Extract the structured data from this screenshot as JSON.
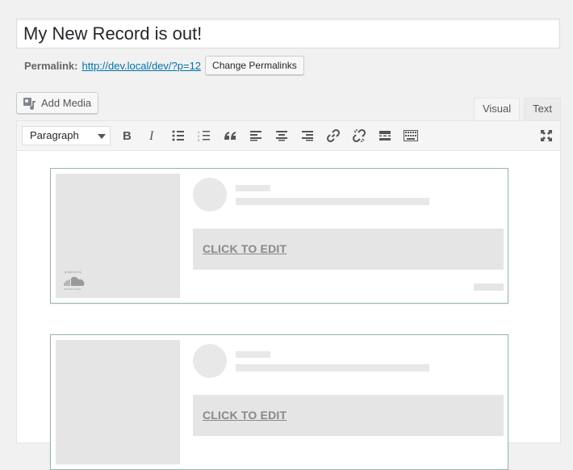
{
  "title": {
    "value": "My New Record is out!"
  },
  "permalink": {
    "label": "Permalink:",
    "url": "http://dev.local/dev/?p=12",
    "button": "Change Permalinks"
  },
  "media": {
    "add_label": "Add Media"
  },
  "tabs": [
    {
      "label": "Visual",
      "active": true
    },
    {
      "label": "Text",
      "active": false
    }
  ],
  "toolbar": {
    "format_value": "Paragraph",
    "buttons": [
      "bold-icon",
      "italic-icon",
      "bullet-list-icon",
      "numbered-list-icon",
      "blockquote-icon",
      "align-left-icon",
      "align-center-icon",
      "align-right-icon",
      "insert-link-icon",
      "remove-link-icon",
      "read-more-icon",
      "toolbar-toggle-icon",
      "fullscreen-icon"
    ]
  },
  "embeds": [
    {
      "cta": "CLICK TO EDIT",
      "powered": "powered by",
      "brand": "SOUNDCLOUD"
    },
    {
      "cta": "CLICK TO EDIT"
    }
  ]
}
